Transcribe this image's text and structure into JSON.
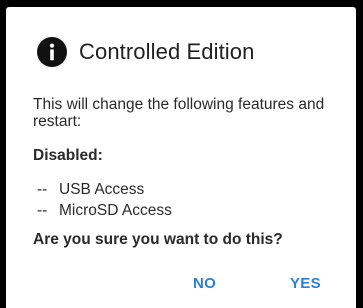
{
  "dialog": {
    "icon": "info-icon",
    "title": "Controlled Edition",
    "message": "This will change the following features and restart:",
    "disabled_heading": "Disabled:",
    "features": [
      {
        "dash": "--",
        "label": "USB Access"
      },
      {
        "dash": "--",
        "label": "MicroSD Access"
      }
    ],
    "confirm_question": "Are you sure you want to do this?",
    "buttons": {
      "no_label": "NO",
      "yes_label": "YES"
    }
  },
  "colors": {
    "accent": "#2d7fd6",
    "text": "#2a2a2a",
    "background": "#ffffff",
    "backdrop": "#000000"
  }
}
